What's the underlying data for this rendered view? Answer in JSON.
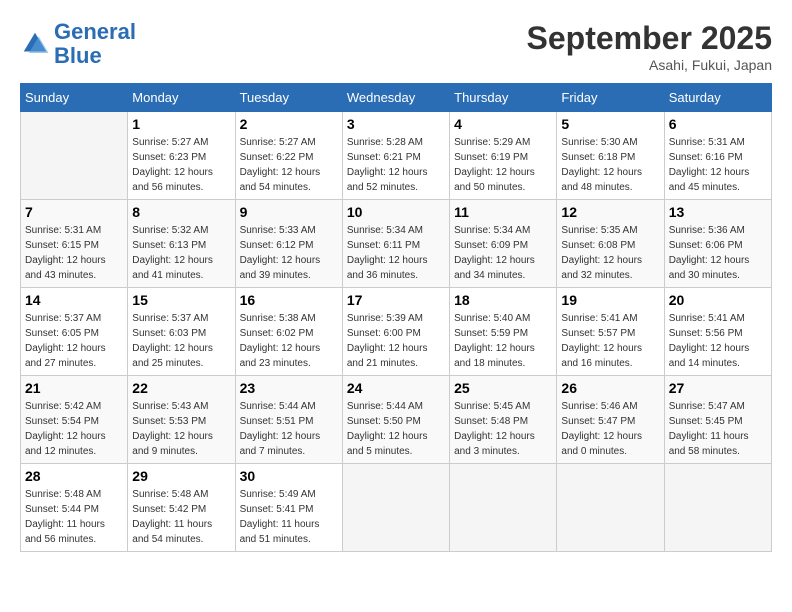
{
  "logo": {
    "line1": "General",
    "line2": "Blue"
  },
  "title": "September 2025",
  "location": "Asahi, Fukui, Japan",
  "weekdays": [
    "Sunday",
    "Monday",
    "Tuesday",
    "Wednesday",
    "Thursday",
    "Friday",
    "Saturday"
  ],
  "weeks": [
    [
      {
        "day": "",
        "info": ""
      },
      {
        "day": "1",
        "info": "Sunrise: 5:27 AM\nSunset: 6:23 PM\nDaylight: 12 hours\nand 56 minutes."
      },
      {
        "day": "2",
        "info": "Sunrise: 5:27 AM\nSunset: 6:22 PM\nDaylight: 12 hours\nand 54 minutes."
      },
      {
        "day": "3",
        "info": "Sunrise: 5:28 AM\nSunset: 6:21 PM\nDaylight: 12 hours\nand 52 minutes."
      },
      {
        "day": "4",
        "info": "Sunrise: 5:29 AM\nSunset: 6:19 PM\nDaylight: 12 hours\nand 50 minutes."
      },
      {
        "day": "5",
        "info": "Sunrise: 5:30 AM\nSunset: 6:18 PM\nDaylight: 12 hours\nand 48 minutes."
      },
      {
        "day": "6",
        "info": "Sunrise: 5:31 AM\nSunset: 6:16 PM\nDaylight: 12 hours\nand 45 minutes."
      }
    ],
    [
      {
        "day": "7",
        "info": "Sunrise: 5:31 AM\nSunset: 6:15 PM\nDaylight: 12 hours\nand 43 minutes."
      },
      {
        "day": "8",
        "info": "Sunrise: 5:32 AM\nSunset: 6:13 PM\nDaylight: 12 hours\nand 41 minutes."
      },
      {
        "day": "9",
        "info": "Sunrise: 5:33 AM\nSunset: 6:12 PM\nDaylight: 12 hours\nand 39 minutes."
      },
      {
        "day": "10",
        "info": "Sunrise: 5:34 AM\nSunset: 6:11 PM\nDaylight: 12 hours\nand 36 minutes."
      },
      {
        "day": "11",
        "info": "Sunrise: 5:34 AM\nSunset: 6:09 PM\nDaylight: 12 hours\nand 34 minutes."
      },
      {
        "day": "12",
        "info": "Sunrise: 5:35 AM\nSunset: 6:08 PM\nDaylight: 12 hours\nand 32 minutes."
      },
      {
        "day": "13",
        "info": "Sunrise: 5:36 AM\nSunset: 6:06 PM\nDaylight: 12 hours\nand 30 minutes."
      }
    ],
    [
      {
        "day": "14",
        "info": "Sunrise: 5:37 AM\nSunset: 6:05 PM\nDaylight: 12 hours\nand 27 minutes."
      },
      {
        "day": "15",
        "info": "Sunrise: 5:37 AM\nSunset: 6:03 PM\nDaylight: 12 hours\nand 25 minutes."
      },
      {
        "day": "16",
        "info": "Sunrise: 5:38 AM\nSunset: 6:02 PM\nDaylight: 12 hours\nand 23 minutes."
      },
      {
        "day": "17",
        "info": "Sunrise: 5:39 AM\nSunset: 6:00 PM\nDaylight: 12 hours\nand 21 minutes."
      },
      {
        "day": "18",
        "info": "Sunrise: 5:40 AM\nSunset: 5:59 PM\nDaylight: 12 hours\nand 18 minutes."
      },
      {
        "day": "19",
        "info": "Sunrise: 5:41 AM\nSunset: 5:57 PM\nDaylight: 12 hours\nand 16 minutes."
      },
      {
        "day": "20",
        "info": "Sunrise: 5:41 AM\nSunset: 5:56 PM\nDaylight: 12 hours\nand 14 minutes."
      }
    ],
    [
      {
        "day": "21",
        "info": "Sunrise: 5:42 AM\nSunset: 5:54 PM\nDaylight: 12 hours\nand 12 minutes."
      },
      {
        "day": "22",
        "info": "Sunrise: 5:43 AM\nSunset: 5:53 PM\nDaylight: 12 hours\nand 9 minutes."
      },
      {
        "day": "23",
        "info": "Sunrise: 5:44 AM\nSunset: 5:51 PM\nDaylight: 12 hours\nand 7 minutes."
      },
      {
        "day": "24",
        "info": "Sunrise: 5:44 AM\nSunset: 5:50 PM\nDaylight: 12 hours\nand 5 minutes."
      },
      {
        "day": "25",
        "info": "Sunrise: 5:45 AM\nSunset: 5:48 PM\nDaylight: 12 hours\nand 3 minutes."
      },
      {
        "day": "26",
        "info": "Sunrise: 5:46 AM\nSunset: 5:47 PM\nDaylight: 12 hours\nand 0 minutes."
      },
      {
        "day": "27",
        "info": "Sunrise: 5:47 AM\nSunset: 5:45 PM\nDaylight: 11 hours\nand 58 minutes."
      }
    ],
    [
      {
        "day": "28",
        "info": "Sunrise: 5:48 AM\nSunset: 5:44 PM\nDaylight: 11 hours\nand 56 minutes."
      },
      {
        "day": "29",
        "info": "Sunrise: 5:48 AM\nSunset: 5:42 PM\nDaylight: 11 hours\nand 54 minutes."
      },
      {
        "day": "30",
        "info": "Sunrise: 5:49 AM\nSunset: 5:41 PM\nDaylight: 11 hours\nand 51 minutes."
      },
      {
        "day": "",
        "info": ""
      },
      {
        "day": "",
        "info": ""
      },
      {
        "day": "",
        "info": ""
      },
      {
        "day": "",
        "info": ""
      }
    ]
  ]
}
